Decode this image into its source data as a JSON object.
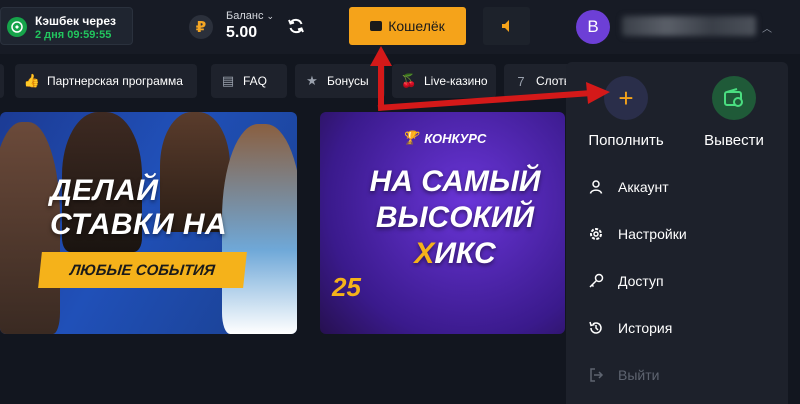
{
  "header": {
    "cashback_title": "Кэшбек через",
    "cashback_time": "2 дня 09:59:55",
    "currency_symbol": "₽",
    "balance_label": "Баланс",
    "balance_value": "5.00",
    "wallet_label": "Кошелёк",
    "avatar_letter": "B"
  },
  "nav": {
    "items": [
      {
        "label": "Партнерская программа",
        "icon": "thumbs-up-icon"
      },
      {
        "label": "FAQ",
        "icon": "book-icon"
      },
      {
        "label": "Бонусы",
        "icon": "star-icon"
      },
      {
        "label": "Live-казино",
        "icon": "cherry-icon"
      },
      {
        "label": "Слоты",
        "icon": "seven-icon"
      }
    ]
  },
  "banners": {
    "bets_title": "ДЕЛАЙ СТАВКИ НА",
    "bets_subtitle": "ЛЮБЫЕ СОБЫТИЯ",
    "contest_tag": "КОНКУРС",
    "contest_title_1": "НА САМЫЙ",
    "contest_title_2": "ВЫСОКИЙ",
    "contest_title_x": "Х",
    "contest_title_3": "ИКС",
    "contest_amount": "25"
  },
  "dropdown": {
    "deposit_label": "Пополнить",
    "withdraw_label": "Вывести",
    "menu": [
      {
        "label": "Аккаунт",
        "icon": "user-icon",
        "disabled": false
      },
      {
        "label": "Настройки",
        "icon": "gear-icon",
        "disabled": false
      },
      {
        "label": "Доступ",
        "icon": "key-icon",
        "disabled": false
      },
      {
        "label": "История",
        "icon": "history-icon",
        "disabled": false
      },
      {
        "label": "Выйти",
        "icon": "logout-icon",
        "disabled": true
      }
    ]
  },
  "colors": {
    "accent": "#f5a31a",
    "success": "#22c55e",
    "background": "#12161f",
    "panel": "#1d212b",
    "annotation_arrow": "#d41919"
  }
}
